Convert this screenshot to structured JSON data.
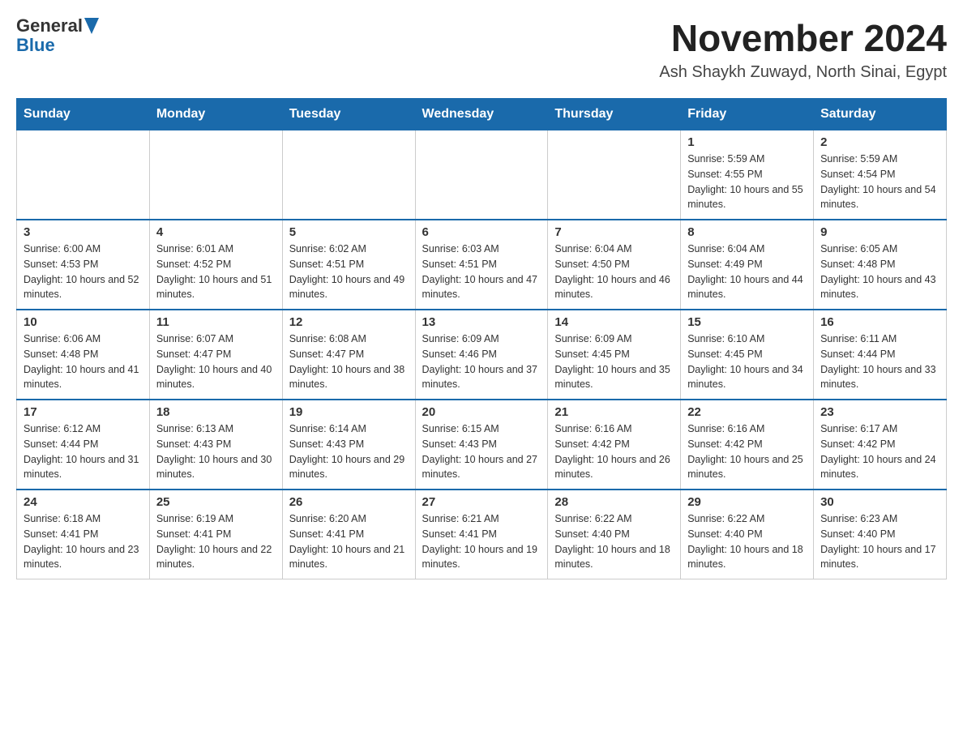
{
  "header": {
    "logo_general": "General",
    "logo_blue": "Blue",
    "month_title": "November 2024",
    "location": "Ash Shaykh Zuwayd, North Sinai, Egypt"
  },
  "weekdays": [
    "Sunday",
    "Monday",
    "Tuesday",
    "Wednesday",
    "Thursday",
    "Friday",
    "Saturday"
  ],
  "weeks": [
    [
      {
        "day": "",
        "info": ""
      },
      {
        "day": "",
        "info": ""
      },
      {
        "day": "",
        "info": ""
      },
      {
        "day": "",
        "info": ""
      },
      {
        "day": "",
        "info": ""
      },
      {
        "day": "1",
        "info": "Sunrise: 5:59 AM\nSunset: 4:55 PM\nDaylight: 10 hours and 55 minutes."
      },
      {
        "day": "2",
        "info": "Sunrise: 5:59 AM\nSunset: 4:54 PM\nDaylight: 10 hours and 54 minutes."
      }
    ],
    [
      {
        "day": "3",
        "info": "Sunrise: 6:00 AM\nSunset: 4:53 PM\nDaylight: 10 hours and 52 minutes."
      },
      {
        "day": "4",
        "info": "Sunrise: 6:01 AM\nSunset: 4:52 PM\nDaylight: 10 hours and 51 minutes."
      },
      {
        "day": "5",
        "info": "Sunrise: 6:02 AM\nSunset: 4:51 PM\nDaylight: 10 hours and 49 minutes."
      },
      {
        "day": "6",
        "info": "Sunrise: 6:03 AM\nSunset: 4:51 PM\nDaylight: 10 hours and 47 minutes."
      },
      {
        "day": "7",
        "info": "Sunrise: 6:04 AM\nSunset: 4:50 PM\nDaylight: 10 hours and 46 minutes."
      },
      {
        "day": "8",
        "info": "Sunrise: 6:04 AM\nSunset: 4:49 PM\nDaylight: 10 hours and 44 minutes."
      },
      {
        "day": "9",
        "info": "Sunrise: 6:05 AM\nSunset: 4:48 PM\nDaylight: 10 hours and 43 minutes."
      }
    ],
    [
      {
        "day": "10",
        "info": "Sunrise: 6:06 AM\nSunset: 4:48 PM\nDaylight: 10 hours and 41 minutes."
      },
      {
        "day": "11",
        "info": "Sunrise: 6:07 AM\nSunset: 4:47 PM\nDaylight: 10 hours and 40 minutes."
      },
      {
        "day": "12",
        "info": "Sunrise: 6:08 AM\nSunset: 4:47 PM\nDaylight: 10 hours and 38 minutes."
      },
      {
        "day": "13",
        "info": "Sunrise: 6:09 AM\nSunset: 4:46 PM\nDaylight: 10 hours and 37 minutes."
      },
      {
        "day": "14",
        "info": "Sunrise: 6:09 AM\nSunset: 4:45 PM\nDaylight: 10 hours and 35 minutes."
      },
      {
        "day": "15",
        "info": "Sunrise: 6:10 AM\nSunset: 4:45 PM\nDaylight: 10 hours and 34 minutes."
      },
      {
        "day": "16",
        "info": "Sunrise: 6:11 AM\nSunset: 4:44 PM\nDaylight: 10 hours and 33 minutes."
      }
    ],
    [
      {
        "day": "17",
        "info": "Sunrise: 6:12 AM\nSunset: 4:44 PM\nDaylight: 10 hours and 31 minutes."
      },
      {
        "day": "18",
        "info": "Sunrise: 6:13 AM\nSunset: 4:43 PM\nDaylight: 10 hours and 30 minutes."
      },
      {
        "day": "19",
        "info": "Sunrise: 6:14 AM\nSunset: 4:43 PM\nDaylight: 10 hours and 29 minutes."
      },
      {
        "day": "20",
        "info": "Sunrise: 6:15 AM\nSunset: 4:43 PM\nDaylight: 10 hours and 27 minutes."
      },
      {
        "day": "21",
        "info": "Sunrise: 6:16 AM\nSunset: 4:42 PM\nDaylight: 10 hours and 26 minutes."
      },
      {
        "day": "22",
        "info": "Sunrise: 6:16 AM\nSunset: 4:42 PM\nDaylight: 10 hours and 25 minutes."
      },
      {
        "day": "23",
        "info": "Sunrise: 6:17 AM\nSunset: 4:42 PM\nDaylight: 10 hours and 24 minutes."
      }
    ],
    [
      {
        "day": "24",
        "info": "Sunrise: 6:18 AM\nSunset: 4:41 PM\nDaylight: 10 hours and 23 minutes."
      },
      {
        "day": "25",
        "info": "Sunrise: 6:19 AM\nSunset: 4:41 PM\nDaylight: 10 hours and 22 minutes."
      },
      {
        "day": "26",
        "info": "Sunrise: 6:20 AM\nSunset: 4:41 PM\nDaylight: 10 hours and 21 minutes."
      },
      {
        "day": "27",
        "info": "Sunrise: 6:21 AM\nSunset: 4:41 PM\nDaylight: 10 hours and 19 minutes."
      },
      {
        "day": "28",
        "info": "Sunrise: 6:22 AM\nSunset: 4:40 PM\nDaylight: 10 hours and 18 minutes."
      },
      {
        "day": "29",
        "info": "Sunrise: 6:22 AM\nSunset: 4:40 PM\nDaylight: 10 hours and 18 minutes."
      },
      {
        "day": "30",
        "info": "Sunrise: 6:23 AM\nSunset: 4:40 PM\nDaylight: 10 hours and 17 minutes."
      }
    ]
  ]
}
